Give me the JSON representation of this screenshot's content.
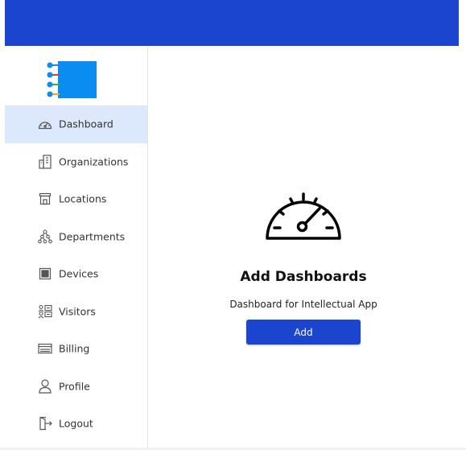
{
  "topbar": {
    "color": "#1b44cf"
  },
  "logo": {
    "icon": "app-logo"
  },
  "sidebar": {
    "items": [
      {
        "label": "Dashboard",
        "icon": "speedometer-icon",
        "active": true
      },
      {
        "label": "Organizations",
        "icon": "building-icon"
      },
      {
        "label": "Locations",
        "icon": "store-icon"
      },
      {
        "label": "Departments",
        "icon": "hierarchy-icon"
      },
      {
        "label": "Devices",
        "icon": "device-grid-icon"
      },
      {
        "label": "Visitors",
        "icon": "visitors-icon"
      },
      {
        "label": "Billing",
        "icon": "card-icon"
      },
      {
        "label": "Profile",
        "icon": "user-icon"
      },
      {
        "label": "Logout",
        "icon": "logout-icon"
      }
    ],
    "active_color": "#dce8fb"
  },
  "main": {
    "icon": "speedometer-icon",
    "title": "Add Dashboards",
    "subtitle": "Dashboard for Intellectual App",
    "add_label": "Add",
    "accent": "#1b44cf"
  }
}
